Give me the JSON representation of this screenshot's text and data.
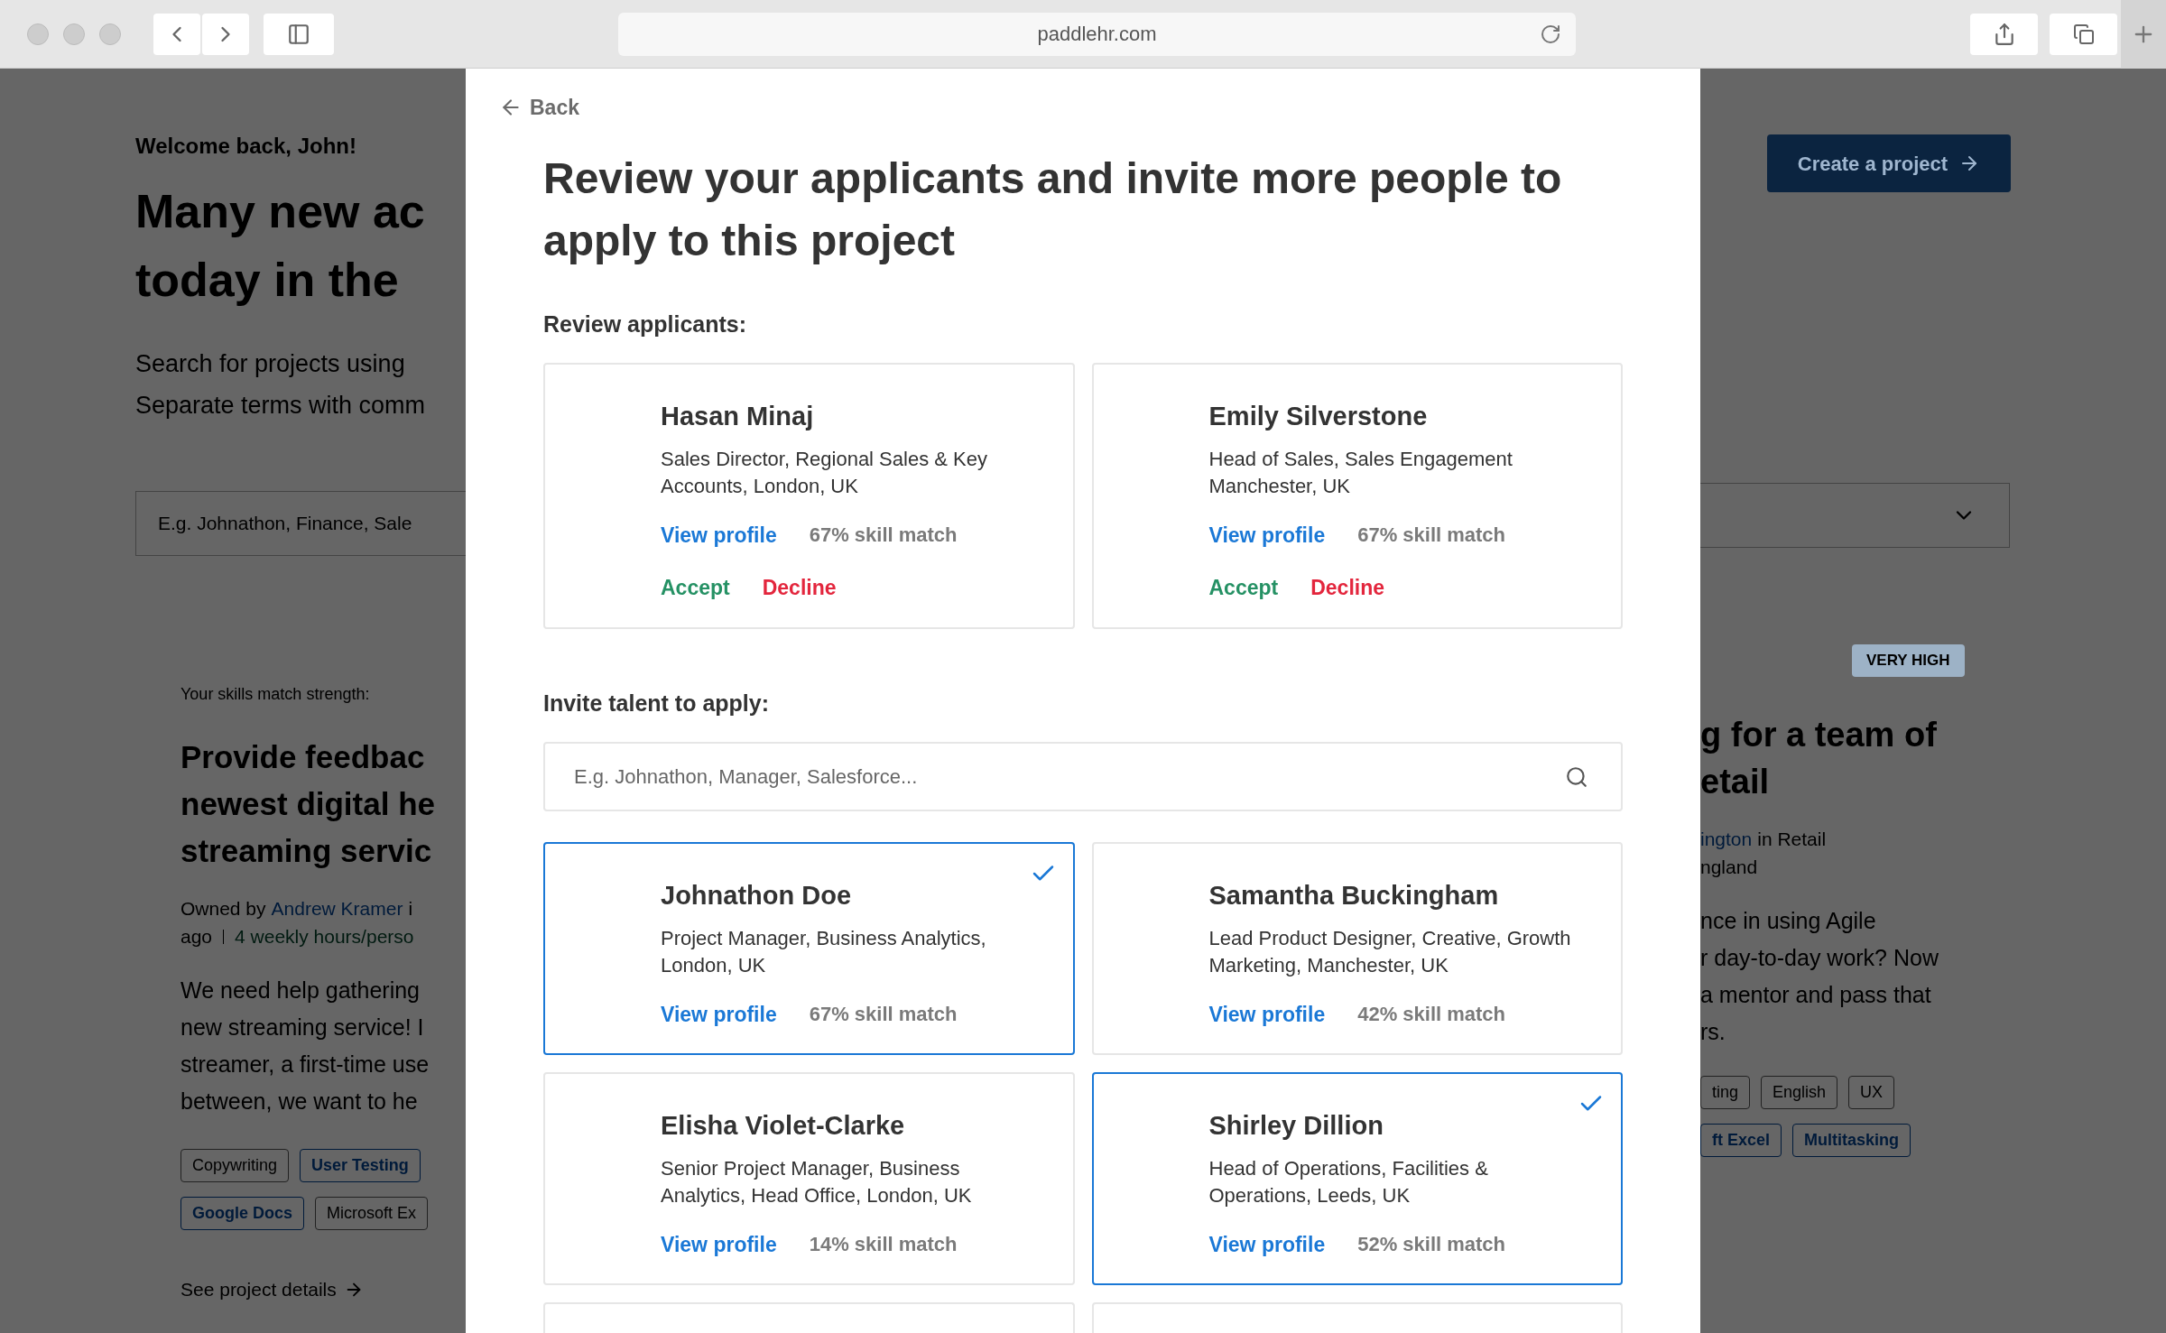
{
  "browser": {
    "url": "paddlehr.com"
  },
  "background_left": {
    "welcome": "Welcome back, John!",
    "heading_lines": [
      "Many new ac",
      "today in the"
    ],
    "intro_lines": [
      "Search for projects using",
      "Separate terms with comm"
    ],
    "search_placeholder": "E.g. Johnathon, Finance, Sale",
    "skills_label": "Your skills match strength:",
    "project_title_lines": [
      "Provide feedbac",
      "newest digital he",
      "streaming servic"
    ],
    "owner_prefix": "Owned by",
    "owner_name": "Andrew Kramer",
    "owner_rest": "i",
    "meta_prefix": "ago",
    "hours": "4 weekly hours/perso",
    "paragraph_lines": [
      "We need help gathering",
      "new streaming service! I",
      "streamer, a first-time use",
      "between, we want to he"
    ],
    "tag_rows": [
      [
        {
          "label": "Copywriting",
          "highlighted": false
        },
        {
          "label": "User Testing",
          "highlighted": true
        }
      ],
      [
        {
          "label": "Google Docs",
          "highlighted": true
        },
        {
          "label": "Microsoft Ex",
          "highlighted": false
        }
      ]
    ],
    "details_link": "See project details"
  },
  "background_right": {
    "create_button": "Create a project",
    "strength_badge": "VERY HIGH",
    "project_title_lines": [
      "g for a team of",
      "etail"
    ],
    "owner_name": "ington",
    "owner_rest": "in Retail",
    "location": "ngland",
    "paragraph_lines": [
      "nce in using Agile",
      "r day-to-day work? Now",
      "a mentor and pass that",
      "rs."
    ],
    "tag_rows": [
      [
        {
          "label": "ting",
          "highlighted": false
        },
        {
          "label": "English",
          "highlighted": false
        },
        {
          "label": "UX",
          "highlighted": false
        }
      ],
      [
        {
          "label": "ft Excel",
          "highlighted": true
        },
        {
          "label": "Multitasking",
          "highlighted": true
        }
      ]
    ]
  },
  "modal": {
    "back": "Back",
    "title": "Review your applicants and invite more people to apply to this project",
    "review_label": "Review applicants:",
    "applicants": [
      {
        "name": "Hasan Minaj",
        "description": "Sales Director, Regional Sales & Key Accounts, London, UK",
        "view_link": "View profile",
        "match": "67% skill match",
        "accept": "Accept",
        "decline": "Decline"
      },
      {
        "name": "Emily Silverstone",
        "description": "Head of Sales, Sales Engagement Manchester, UK",
        "view_link": "View profile",
        "match": "67% skill match",
        "accept": "Accept",
        "decline": "Decline"
      }
    ],
    "invite_label": "Invite talent to apply:",
    "search_placeholder": "E.g. Johnathon, Manager, Salesforce...",
    "talent": [
      {
        "name": "Johnathon Doe",
        "description": "Project Manager, Business Analytics, London, UK",
        "view_link": "View profile",
        "match": "67% skill match",
        "selected": true
      },
      {
        "name": "Samantha Buckingham",
        "description": "Lead Product Designer, Creative, Growth Marketing, Manchester, UK",
        "view_link": "View profile",
        "match": "42% skill match",
        "selected": false
      },
      {
        "name": "Elisha Violet-Clarke",
        "description": "Senior Project Manager, Business Analytics, Head Office, London, UK",
        "view_link": "View profile",
        "match": "14% skill match",
        "selected": false
      },
      {
        "name": "Shirley Dillion",
        "description": "Head of Operations, Facilities & Operations, Leeds, UK",
        "view_link": "View profile",
        "match": "52% skill match",
        "selected": true
      }
    ]
  }
}
